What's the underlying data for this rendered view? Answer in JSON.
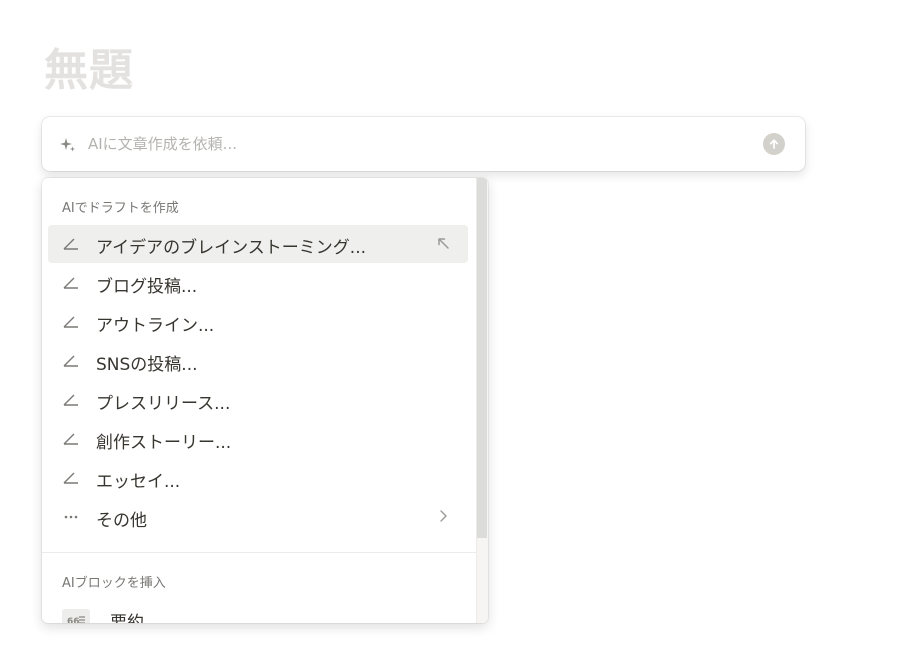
{
  "page": {
    "title": "無題"
  },
  "ai_prompt": {
    "placeholder": "AIに文章作成を依頼...",
    "sparkle_icon": "sparkle-icon",
    "send_icon": "arrow-up-circle-icon"
  },
  "menu": {
    "draft_section": {
      "header": "AIでドラフトを作成",
      "items": [
        {
          "label": "アイデアのブレインストーミング...",
          "icon": "pencil-icon",
          "active": true,
          "trail": "enter-arrow-icon"
        },
        {
          "label": "ブログ投稿...",
          "icon": "pencil-icon"
        },
        {
          "label": "アウトライン...",
          "icon": "pencil-icon"
        },
        {
          "label": "SNSの投稿...",
          "icon": "pencil-icon"
        },
        {
          "label": "プレスリリース...",
          "icon": "pencil-icon"
        },
        {
          "label": "創作ストーリー...",
          "icon": "pencil-icon"
        },
        {
          "label": "エッセイ...",
          "icon": "pencil-icon"
        },
        {
          "label": "その他",
          "icon": "more-dots-icon",
          "trail": "chevron-right-icon"
        }
      ]
    },
    "block_section": {
      "header": "AIブロックを挿入",
      "items": [
        {
          "label": "要約",
          "icon": "summary-block-icon"
        }
      ]
    }
  },
  "colors": {
    "title_placeholder": "#e3e2e0",
    "active_row": "#efefed",
    "text": "#37352f",
    "muted": "#787774"
  }
}
